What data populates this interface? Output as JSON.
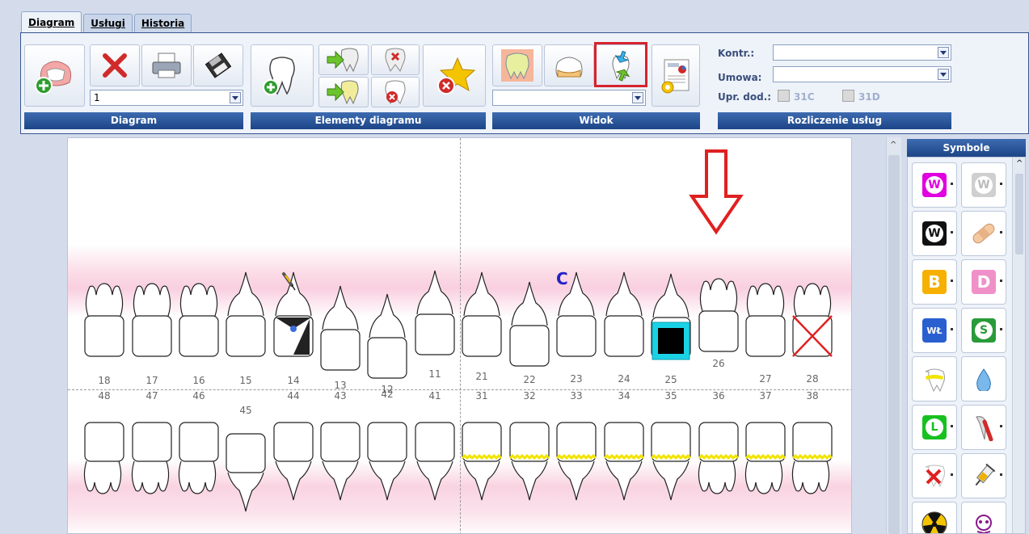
{
  "tabs": [
    "Diagram",
    "Usługi",
    "Historia"
  ],
  "ribbon": {
    "groups": [
      "Diagram",
      "Elementy diagramu",
      "Widok",
      "Rozliczenie usług"
    ],
    "diagram_select_value": "1",
    "view_select_value": "",
    "labels": {
      "kontr": "Kontr.:",
      "umowa": "Umowa:",
      "upr": "Upr. dod.:"
    },
    "checkboxes": [
      "31C",
      "31D"
    ]
  },
  "teeth": {
    "upper_numbers": [
      "18",
      "17",
      "16",
      "15",
      "14",
      "13",
      "12",
      "11",
      "21",
      "22",
      "23",
      "24",
      "25",
      "26",
      "27",
      "28"
    ],
    "lower_numbers": [
      "48",
      "47",
      "46",
      "45",
      "44",
      "43",
      "42",
      "41",
      "31",
      "32",
      "33",
      "34",
      "35",
      "36",
      "37",
      "38"
    ],
    "tooth_mark_letter": "C"
  },
  "symbols_panel": {
    "title": "Symbole",
    "badges": {
      "w": "W",
      "b": "B",
      "d": "D",
      "l": "L",
      "s": "S",
      "wl": "WŁ"
    }
  },
  "colors": {
    "accent": "#1d4588",
    "highlight": "#d6232e",
    "arrow": "#e02020",
    "crown_filling": "#f2e400",
    "ring": "#1ad2e6"
  }
}
